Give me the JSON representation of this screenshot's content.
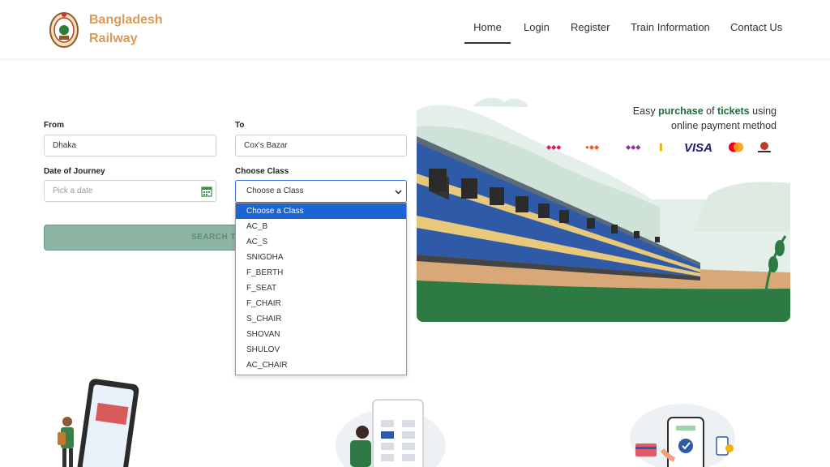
{
  "header": {
    "brand_line1": "Bangladesh",
    "brand_line2": "Railway",
    "nav": [
      "Home",
      "Login",
      "Register",
      "Train Information",
      "Contact Us"
    ]
  },
  "form": {
    "from_label": "From",
    "from_value": "Dhaka",
    "to_label": "To",
    "to_value": "Cox's Bazar",
    "date_label": "Date of Journey",
    "date_placeholder": "Pick a date",
    "class_label": "Choose Class",
    "class_value": "Choose a Class",
    "search_label": "SEARCH TR"
  },
  "class_dropdown": {
    "options": [
      "Choose a Class",
      "AC_B",
      "AC_S",
      "SNIGDHA",
      "F_BERTH",
      "F_SEAT",
      "F_CHAIR",
      "S_CHAIR",
      "SHOVAN",
      "SHULOV",
      "AC_CHAIR"
    ],
    "selected_index": 0
  },
  "hero": {
    "line1_a": "Easy ",
    "line1_b": "purchase",
    "line1_c": " of ",
    "line1_d": "tickets",
    "line1_e": " using",
    "line2": "online payment method",
    "payment_logos": [
      "bkash-logo",
      "nagad-logo",
      "rocket-logo",
      "upay-logo",
      "visa-logo",
      "mastercard-logo",
      "dbbl-nexus-logo"
    ],
    "visa_text": "VISA"
  },
  "colors": {
    "brand": "#d99a55",
    "select_highlight": "#1a64d6",
    "search_button": "#8db5a2",
    "hero_green": "#1e6e3a"
  }
}
